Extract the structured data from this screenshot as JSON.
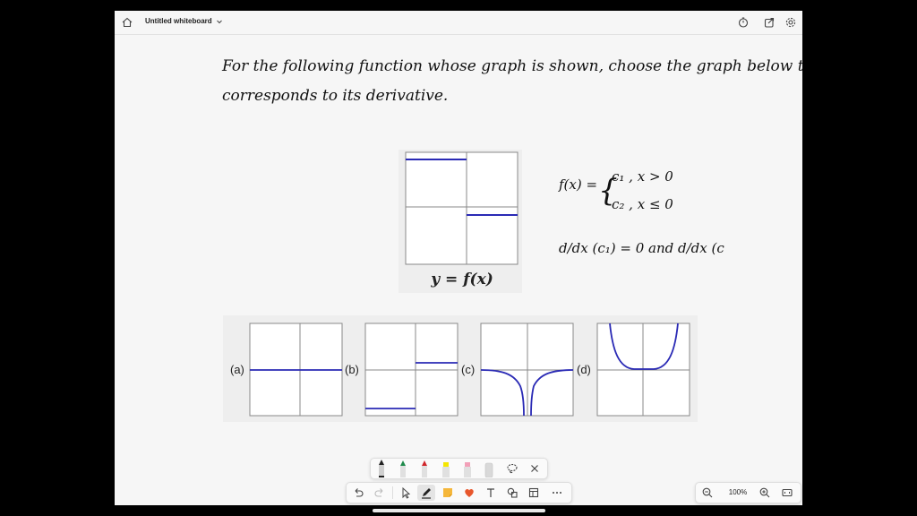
{
  "titlebar": {
    "title": "Untitled whiteboard",
    "icons": [
      "home-icon",
      "chevron-down-icon",
      "timer-icon",
      "share-icon",
      "settings-gear-icon"
    ]
  },
  "whiteboard": {
    "question_line1": "For the following function whose graph is shown, choose the graph below that",
    "question_line2": "corresponds to its derivative.",
    "graph_caption": "y = f(x)",
    "notes": {
      "fx": "f(x) =",
      "brace": "{",
      "case1": "c₁  ,  x > 0",
      "case2": "c₂  ,  x ≤ 0",
      "deriv_line": "d/dx (c₁) = 0  and  d/dx (c"
    },
    "option_labels": [
      "(a)",
      "(b)",
      "(c)",
      "(d)"
    ]
  },
  "pen_tray": {
    "tools": [
      "black-pen",
      "green-pen",
      "red-pen",
      "yellow-highlighter",
      "pink-highlighter",
      "eraser",
      "lasso-icon",
      "close-icon"
    ],
    "colors": {
      "black": "#222222",
      "green": "#1f8a4c",
      "red": "#d0262b",
      "yellow": "#f4e600",
      "pink": "#f2a0b8",
      "eraser": "#d9d9d9"
    }
  },
  "main_toolbar": {
    "tools": [
      "undo-icon",
      "redo-icon",
      "select-icon",
      "pen-icon",
      "sticky-note-icon",
      "heart-reaction-icon",
      "text-icon",
      "shapes-icon",
      "templates-icon",
      "more-icon"
    ]
  },
  "zoom": {
    "level": "100%"
  },
  "colors": {
    "curve": "#2a2ab5",
    "grid": "#888888",
    "app_bg": "#f6f6f6"
  }
}
